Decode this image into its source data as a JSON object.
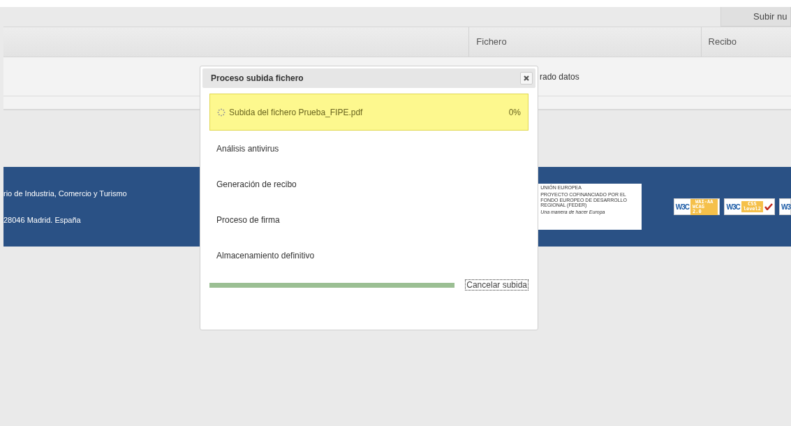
{
  "top_button": {
    "label": "Subir nu"
  },
  "table": {
    "columns": [
      "Fichero",
      "Recibo"
    ],
    "empty_message": "rado datos"
  },
  "footer": {
    "lines": [
      "rio de Industria, Comercio y Turismo",
      "28046 Madrid. España"
    ],
    "eu_logo": {
      "title": "UNIÓN EUROPEA",
      "body": "PROYECTO COFINANCIADO POR EL FONDO EUROPEO DE DESARROLLO REGIONAL (FEDER)",
      "motto": "Una manera de hacer Europa"
    },
    "badges": [
      {
        "kind": "wcag",
        "mark": "W3C",
        "lines": [
          "WAI-AA",
          "WCAG 2.0"
        ]
      },
      {
        "kind": "css",
        "mark": "W3C",
        "lines": [
          "CSS",
          "level2"
        ]
      },
      {
        "kind": "partial",
        "mark": "W3"
      }
    ]
  },
  "dialog": {
    "title": "Proceso subida fichero",
    "steps": [
      {
        "label": "Subida del fichero Prueba_FIPE.pdf",
        "active": true,
        "percent": "0%"
      },
      {
        "label": "Análisis antivirus",
        "active": false
      },
      {
        "label": "Generación de recibo",
        "active": false
      },
      {
        "label": "Proceso de firma",
        "active": false
      },
      {
        "label": "Almacenamiento definitivo",
        "active": false
      }
    ],
    "progress": {
      "level": 1
    },
    "cancel_label": "Cancelar subida"
  }
}
